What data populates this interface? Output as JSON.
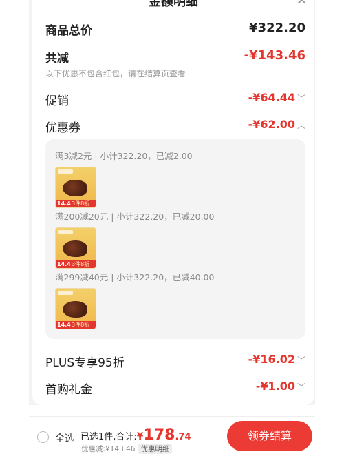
{
  "header": {
    "title": "金额明细",
    "close_icon": "close-icon"
  },
  "rows": {
    "total_price": {
      "label": "商品总价",
      "amount": "¥322.20"
    },
    "total_reduction": {
      "label": "共减",
      "amount": "-¥143.46",
      "note": "以下优惠不包含红包，请在结算页查看"
    },
    "promotion": {
      "label": "促销",
      "amount": "-¥64.44",
      "chevron": "chevron-down-icon"
    },
    "coupon": {
      "label": "优惠券",
      "amount": "-¥62.00",
      "chevron": "chevron-up-icon"
    },
    "plus": {
      "label": "PLUS专享95折",
      "amount": "-¥16.02",
      "chevron": "chevron-down-icon"
    },
    "first_gift": {
      "label": "首购礼金",
      "amount": "-¥1.00",
      "chevron": "chevron-down-icon"
    }
  },
  "coupon_details": [
    {
      "condition": "满3减2元 | 小计322.20，已减2.00",
      "product_price_tag": "14.4",
      "product_deal_tag": "3件8折"
    },
    {
      "condition": "满200减20元 | 小计322.20，已减20.00",
      "product_price_tag": "14.4",
      "product_deal_tag": "3件8折"
    },
    {
      "condition": "满299减40元 | 小计322.20，已减40.00",
      "product_price_tag": "14.4",
      "product_deal_tag": "3件8折"
    }
  ],
  "footer": {
    "select_all": "全选",
    "selected_text": "已选1件,合计:",
    "currency": "¥",
    "total_int": "178",
    "total_dec": ".74",
    "discount_text": "优惠减:¥143.46",
    "discount_detail": "优惠明细",
    "checkout_button": "领券结算"
  },
  "colors": {
    "accent": "#e4362e",
    "button": "#ec3b35"
  }
}
